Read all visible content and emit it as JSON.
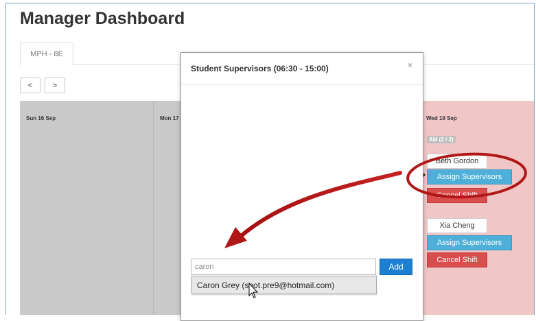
{
  "page": {
    "title": "Manager Dashboard"
  },
  "tabs": [
    {
      "label": "MPH - 8E"
    }
  ],
  "nav": {
    "prev": "<",
    "next": ">"
  },
  "calendar": {
    "days": [
      {
        "label": "Sun 16 Sep"
      },
      {
        "label": "Mon 17"
      },
      {
        "label": "Wed 19 Sep"
      }
    ],
    "wed": {
      "am_badge": "AM (2 / 2)",
      "slots": [
        {
          "person": "Beth Gordon",
          "assign": "Assign Supervisors",
          "cancel": "Cancel Shift"
        },
        {
          "person": "Xia Cheng",
          "assign": "Assign Supervisors",
          "cancel": "Cancel Shift"
        }
      ]
    }
  },
  "modal": {
    "title": "Student Supervisors (06:30 - 15:00)",
    "close": "×",
    "search_value": "caron",
    "add_label": "Add",
    "suggestion": "Caron Grey (spot.pre9@hotmail.com)"
  },
  "colors": {
    "assign": "#4eb0d8",
    "cancel": "#d94d4d",
    "add": "#1d7fd2",
    "annotation": "#b01818"
  }
}
